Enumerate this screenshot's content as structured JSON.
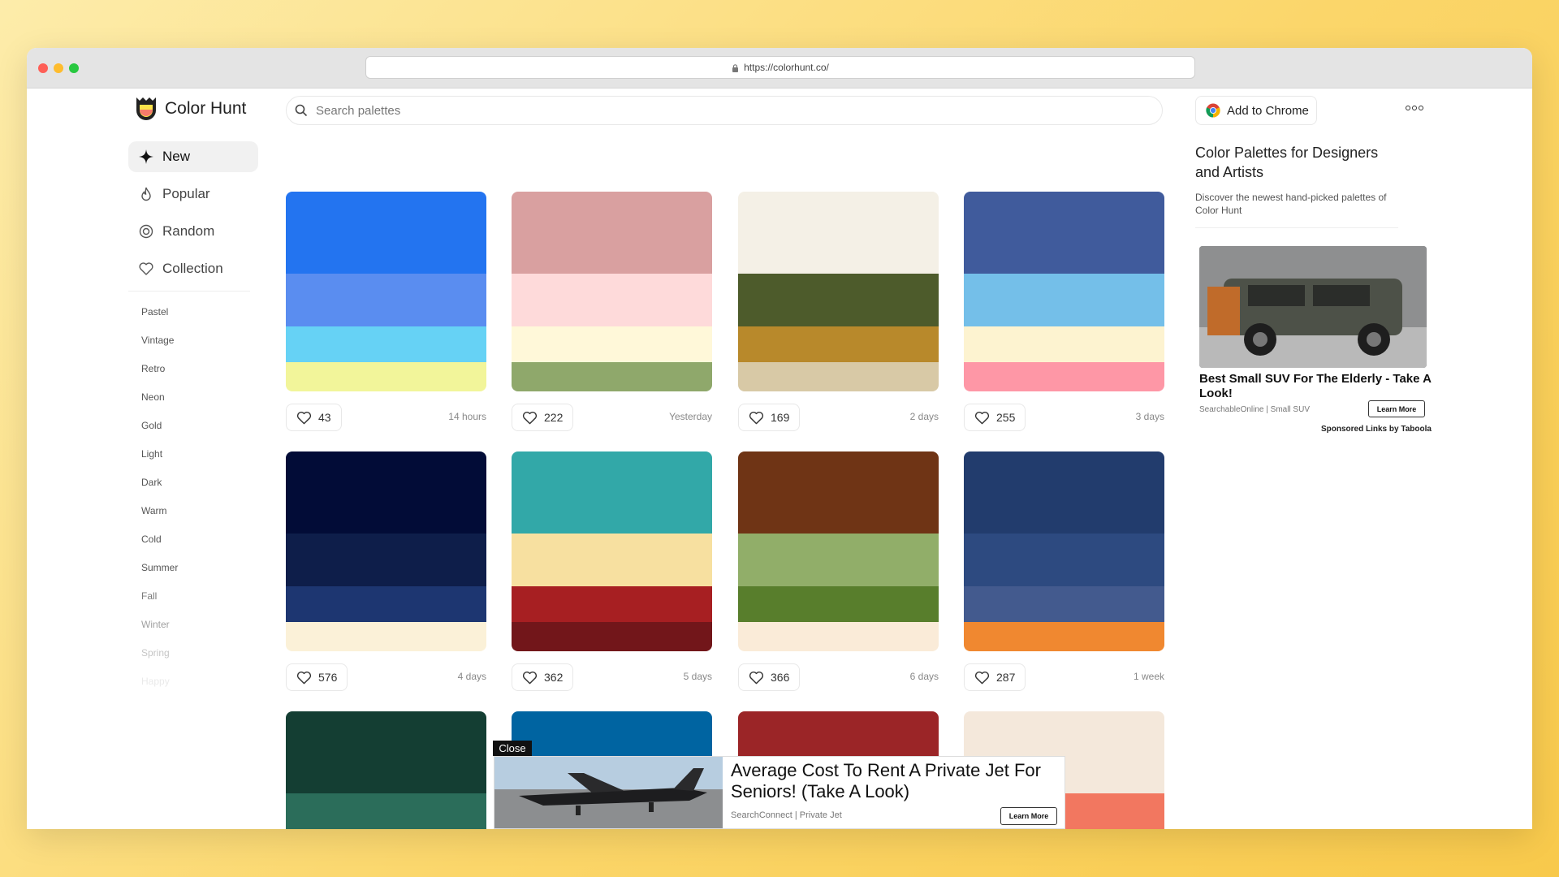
{
  "browser": {
    "url": "https://colorhunt.co/"
  },
  "header": {
    "logo_text": "Color Hunt",
    "search_placeholder": "Search palettes",
    "chrome_button": "Add to Chrome"
  },
  "nav": {
    "items": [
      {
        "label": "New",
        "icon": "sparkle-icon"
      },
      {
        "label": "Popular",
        "icon": "flame-icon"
      },
      {
        "label": "Random",
        "icon": "random-icon"
      },
      {
        "label": "Collection",
        "icon": "heart-icon"
      }
    ],
    "tags": [
      "Pastel",
      "Vintage",
      "Retro",
      "Neon",
      "Gold",
      "Light",
      "Dark",
      "Warm",
      "Cold",
      "Summer",
      "Fall",
      "Winter",
      "Spring",
      "Happy"
    ]
  },
  "palettes": [
    {
      "colors": [
        "#2374f0",
        "#5a8df0",
        "#66d2f5",
        "#f2f59a"
      ],
      "likes": "43",
      "time": "14 hours"
    },
    {
      "colors": [
        "#d9a0a0",
        "#fedada",
        "#fff8d9",
        "#8fa86b"
      ],
      "likes": "222",
      "time": "Yesterday"
    },
    {
      "colors": [
        "#f4f0e6",
        "#4d5b2b",
        "#b8892b",
        "#d8c9a6"
      ],
      "likes": "169",
      "time": "2 days"
    },
    {
      "colors": [
        "#405b9c",
        "#74bfe9",
        "#fdf3d0",
        "#fe97a6"
      ],
      "likes": "255",
      "time": "3 days"
    },
    {
      "colors": [
        "#020c37",
        "#0e1e4a",
        "#1d3671",
        "#fbf1d8"
      ],
      "likes": "576",
      "time": "4 days"
    },
    {
      "colors": [
        "#32a8a8",
        "#f7e0a0",
        "#a71f22",
        "#72161a"
      ],
      "likes": "362",
      "time": "5 days"
    },
    {
      "colors": [
        "#6f3415",
        "#91ae69",
        "#587e2c",
        "#faebd8"
      ],
      "likes": "366",
      "time": "6 days"
    },
    {
      "colors": [
        "#223c6d",
        "#2d4a80",
        "#435a8e",
        "#f08830"
      ],
      "likes": "287",
      "time": "1 week"
    },
    {
      "colors": [
        "#143e33",
        "#2b6d5a",
        "#c9a046",
        "#ffffff"
      ],
      "likes": "",
      "time": ""
    },
    {
      "colors": [
        "#0064a1",
        "#8fc4e8",
        "#ffffff",
        "#ffffff"
      ],
      "likes": "",
      "time": ""
    },
    {
      "colors": [
        "#9b2527",
        "#ee5a3c",
        "#ffffff",
        "#ffffff"
      ],
      "likes": "",
      "time": ""
    },
    {
      "colors": [
        "#f4e8db",
        "#f27760",
        "#2d578f",
        "#ffffff"
      ],
      "likes": "",
      "time": ""
    }
  ],
  "sidebar": {
    "title": "Color Palettes for Designers and Artists",
    "description": "Discover the newest hand-picked palettes of Color Hunt",
    "ad": {
      "title": "Best Small SUV For The Elderly - Take A Look!",
      "source": "SearchableOnline | Small SUV",
      "button": "Learn More",
      "sponsor": "Sponsored Links by Taboola"
    }
  },
  "bottom_ad": {
    "close": "Close",
    "title": "Average Cost To Rent A Private Jet For Seniors! (Take A Look)",
    "source": "SearchConnect | Private Jet",
    "button": "Learn More"
  },
  "colors": {
    "accent": "#f5c542",
    "background": "#ffffff",
    "text": "#222222"
  }
}
